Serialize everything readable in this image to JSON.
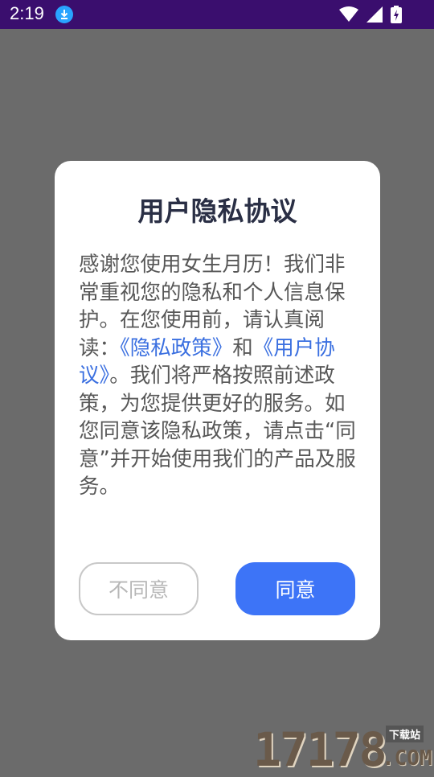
{
  "status_bar": {
    "time": "2:19",
    "icons": [
      "download-icon",
      "wifi-icon",
      "signal-icon",
      "battery-charging-icon"
    ]
  },
  "dialog": {
    "title": "用户隐私协议",
    "body": {
      "intro": "感谢您使用女生月历！我们非常重视您的隐私和个人信息保护。在您使用前，请认真阅读：",
      "privacy_link": "《隐私政策》",
      "and": "和",
      "user_agreement_link": "《用户协议》",
      "outro": "。我们将严格按照前述政策，为您提供更好的服务。如您同意该隐私政策，请点击“同意”并开始使用我们的产品及服务。"
    },
    "disagree_label": "不同意",
    "agree_label": "同意"
  },
  "watermark": {
    "number": "17178",
    "tag": "下载站",
    "domain": ".COM"
  },
  "colors": {
    "status_bar": "#3a0e6e",
    "scrim": "#6b6b6b",
    "link": "#3a6fe0",
    "agree_button": "#3d74f7",
    "title": "#2a2f45"
  }
}
